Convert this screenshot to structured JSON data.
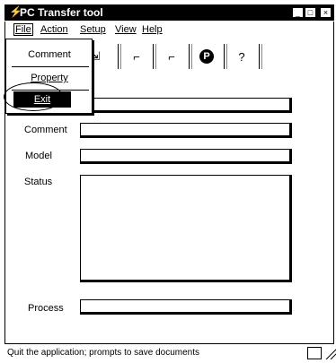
{
  "window": {
    "title": "PC Transfer tool",
    "title_icon": "lightning-icon",
    "controls": [
      "minimize-icon",
      "maximize-icon",
      "close-icon"
    ]
  },
  "menubar": {
    "items": [
      "File",
      "Action",
      "Setup",
      "View",
      "Help"
    ]
  },
  "file_menu": {
    "items": [
      "Comment",
      "Property",
      "Exit"
    ],
    "selected": "Exit"
  },
  "toolbar": {
    "buttons": [
      "transfer-icon",
      "upload-icon",
      "download-icon",
      "p-icon",
      "help-icon"
    ],
    "glyphs": [
      "⇲",
      "⌐",
      "⌐",
      "P",
      "?"
    ]
  },
  "form": {
    "labels": [
      "Comment",
      "Model",
      "Status",
      "Process"
    ],
    "values": {
      "comment": "",
      "model": "",
      "status": "",
      "process": ""
    }
  },
  "statusbar": {
    "text": "Quit the application; prompts to save documents"
  }
}
